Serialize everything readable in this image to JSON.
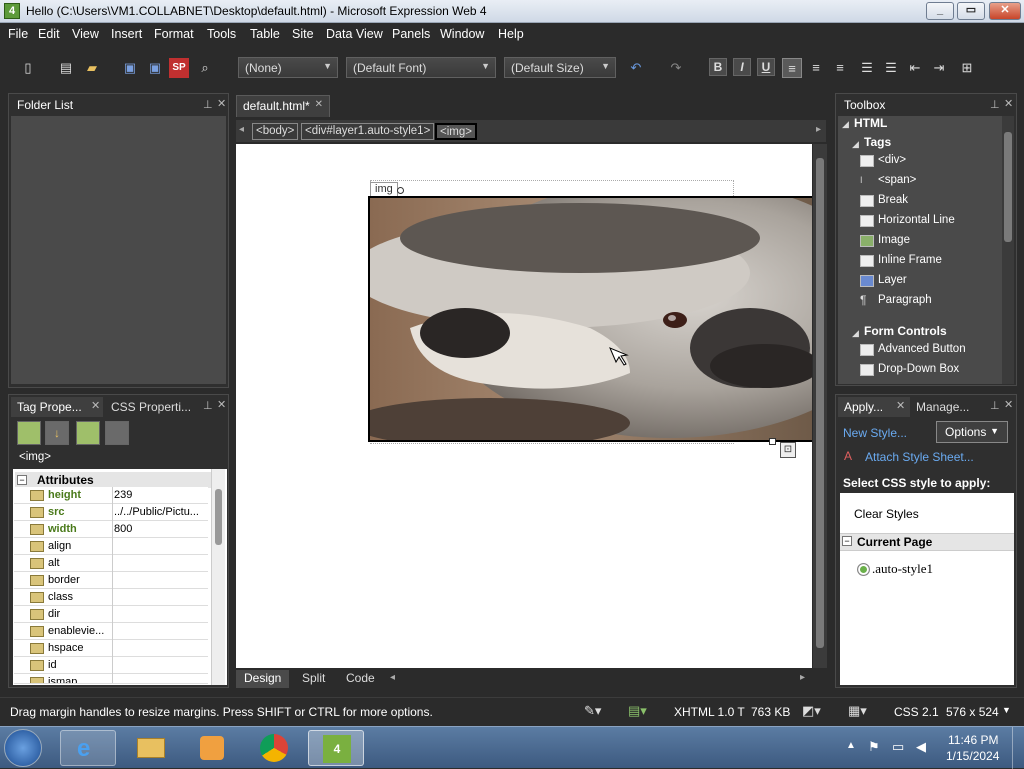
{
  "window": {
    "title": "Hello (C:\\Users\\VM1.COLLABNET\\Desktop\\default.html) - Microsoft Expression Web 4",
    "app_icon": "4"
  },
  "menu": [
    "File",
    "Edit",
    "View",
    "Insert",
    "Format",
    "Tools",
    "Table",
    "Site",
    "Data View",
    "Panels",
    "Window",
    "Help"
  ],
  "toolbar": {
    "style": "(None)",
    "font": "(Default Font)",
    "size": "(Default Size)",
    "bold": "B",
    "italic": "I",
    "underline": "U"
  },
  "folder_list": {
    "title": "Folder List"
  },
  "document": {
    "tab": "default.html*",
    "breadcrumbs": [
      "<body>",
      "<div#layer1.auto-style1>",
      "<img>"
    ],
    "img_label": "img"
  },
  "view_tabs": [
    "Design",
    "Split",
    "Code"
  ],
  "tag_properties": {
    "tab1": "Tag Prope...",
    "tab2": "CSS Properti...",
    "current_tag": "<img>",
    "section": "Attributes",
    "rows": [
      {
        "name": "height",
        "value": "239"
      },
      {
        "name": "src",
        "value": "../../Public/Pictu..."
      },
      {
        "name": "width",
        "value": "800"
      },
      {
        "name": "align",
        "value": ""
      },
      {
        "name": "alt",
        "value": ""
      },
      {
        "name": "border",
        "value": ""
      },
      {
        "name": "class",
        "value": ""
      },
      {
        "name": "dir",
        "value": ""
      },
      {
        "name": "enablevie...",
        "value": ""
      },
      {
        "name": "hspace",
        "value": ""
      },
      {
        "name": "id",
        "value": ""
      },
      {
        "name": "ismap",
        "value": ""
      }
    ]
  },
  "toolbox": {
    "title": "Toolbox",
    "html": "HTML",
    "tags_header": "Tags",
    "tags": [
      "<div>",
      "<span>",
      "Break",
      "Horizontal Line",
      "Image",
      "Inline Frame",
      "Layer",
      "Paragraph"
    ],
    "form_header": "Form Controls",
    "form": [
      "Advanced Button",
      "Drop-Down Box"
    ]
  },
  "apply_styles": {
    "tab1": "Apply...",
    "tab2": "Manage...",
    "new_style": "New Style...",
    "options": "Options",
    "attach": "Attach Style Sheet...",
    "select_label": "Select CSS style to apply:",
    "clear": "Clear Styles",
    "current_page": "Current Page",
    "style": ".auto-style1"
  },
  "status": {
    "message": "Drag margin handles to resize margins. Press SHIFT or CTRL for more options.",
    "doctype": "XHTML 1.0 T",
    "size": "763 KB",
    "css": "CSS 2.1",
    "dims": "576 x 524"
  },
  "taskbar": {
    "time": "11:46 PM",
    "date": "1/15/2024"
  }
}
